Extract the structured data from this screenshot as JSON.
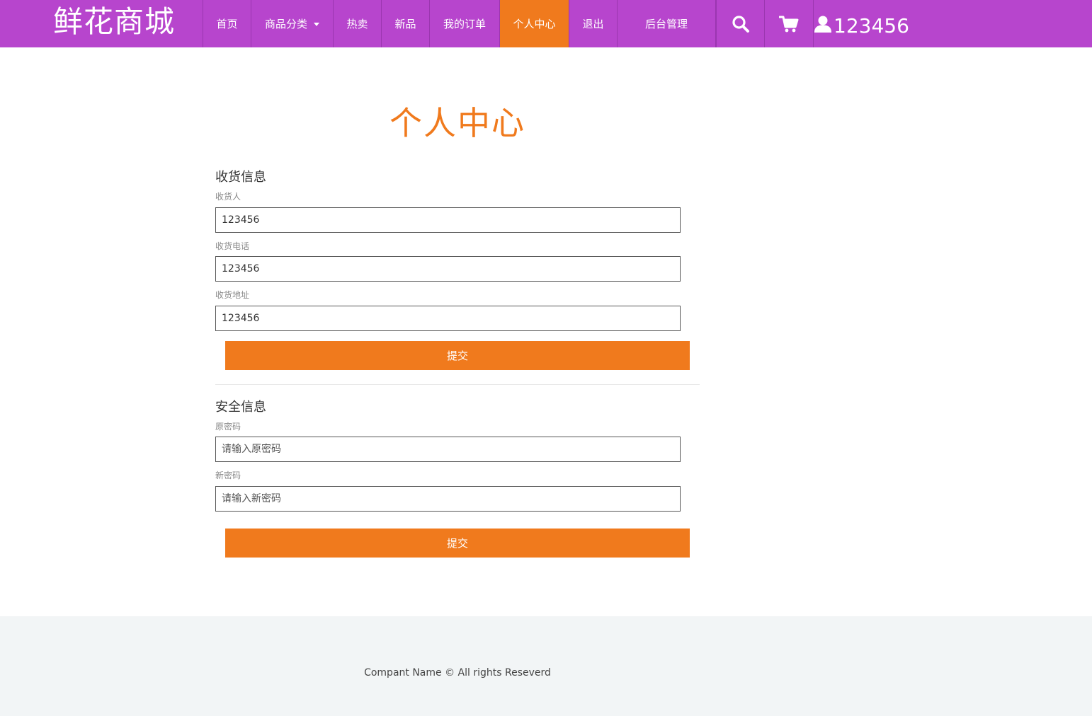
{
  "header": {
    "brand": "鲜花商城",
    "nav": [
      {
        "label": "首页",
        "active": false
      },
      {
        "label": "商品分类",
        "active": false,
        "dropdown": true
      },
      {
        "label": "热卖",
        "active": false
      },
      {
        "label": "新品",
        "active": false
      },
      {
        "label": "我的订单",
        "active": false
      },
      {
        "label": "个人中心",
        "active": true
      },
      {
        "label": "退出",
        "active": false
      },
      {
        "label": "后台管理",
        "active": false
      }
    ],
    "icons": {
      "search": "search-icon",
      "cart": "cart-icon",
      "user": "user-icon"
    },
    "username": "123456"
  },
  "main": {
    "title": "个人中心",
    "shipping": {
      "heading": "收货信息",
      "receiver_label": "收货人",
      "receiver_value": "123456",
      "phone_label": "收货电话",
      "phone_value": "123456",
      "address_label": "收货地址",
      "address_value": "123456",
      "submit_label": "提交"
    },
    "security": {
      "heading": "安全信息",
      "old_password_label": "原密码",
      "old_password_placeholder": "请输入原密码",
      "new_password_label": "新密码",
      "new_password_placeholder": "请输入新密码",
      "submit_label": "提交"
    }
  },
  "footer": {
    "text": "Compant Name © All rights Reseverd"
  },
  "colors": {
    "header_bg": "#b745cd",
    "accent": "#f07a1d",
    "footer_bg": "#f2f5f6"
  }
}
